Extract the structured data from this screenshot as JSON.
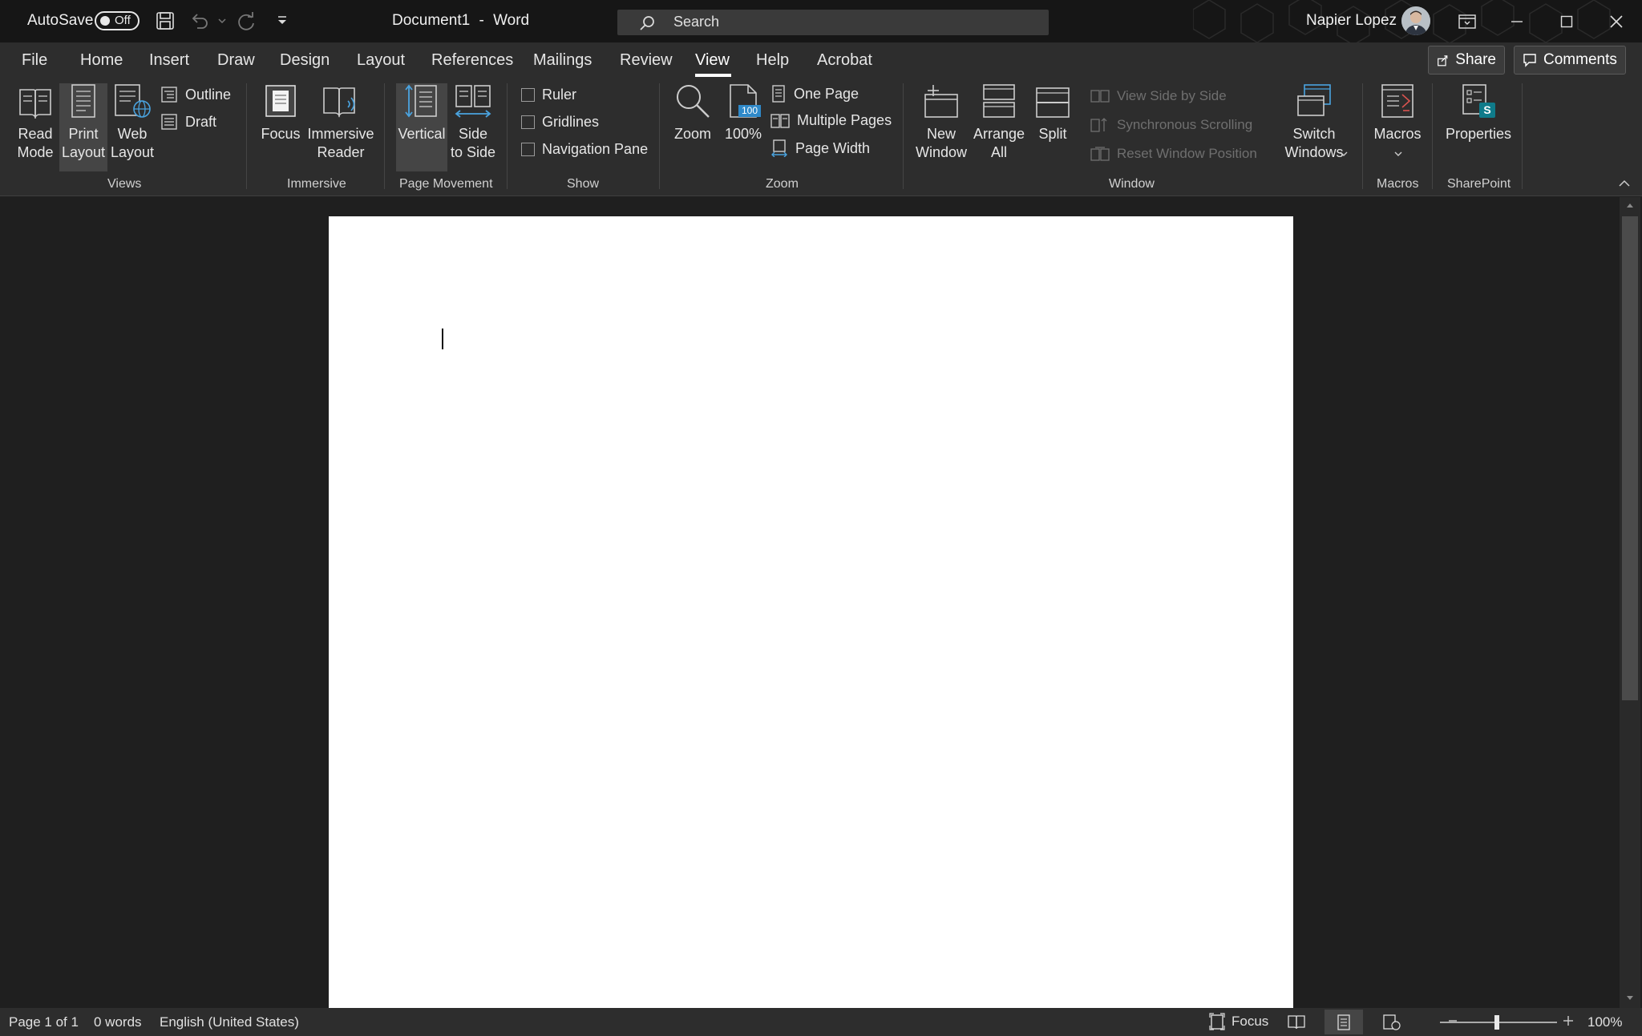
{
  "titlebar": {
    "autosave_label": "AutoSave",
    "autosave_state": "Off",
    "document_title": "Document1",
    "title_separator": "-",
    "app_name": "Word",
    "search_placeholder": "Search",
    "user_name": "Napier Lopez"
  },
  "tabs": [
    "File",
    "Home",
    "Insert",
    "Draw",
    "Design",
    "Layout",
    "References",
    "Mailings",
    "Review",
    "View",
    "Help",
    "Acrobat"
  ],
  "active_tab": "View",
  "share_label": "Share",
  "comments_label": "Comments",
  "ribbon": {
    "views": {
      "read_mode": [
        "Read",
        "Mode"
      ],
      "print_layout": [
        "Print",
        "Layout"
      ],
      "web_layout": [
        "Web",
        "Layout"
      ],
      "outline": "Outline",
      "draft": "Draft",
      "group": "Views"
    },
    "immersive": {
      "focus": "Focus",
      "immersive_reader": [
        "Immersive",
        "Reader"
      ],
      "group": "Immersive"
    },
    "page_movement": {
      "vertical": "Vertical",
      "side_to_side": [
        "Side",
        "to Side"
      ],
      "group": "Page Movement"
    },
    "show": {
      "ruler": "Ruler",
      "gridlines": "Gridlines",
      "navigation_pane": "Navigation Pane",
      "group": "Show"
    },
    "zoom": {
      "zoom": "Zoom",
      "hundred": "100%",
      "hundred_badge": "100",
      "one_page": "One Page",
      "multiple_pages": "Multiple Pages",
      "page_width": "Page Width",
      "group": "Zoom"
    },
    "window": {
      "new_window": [
        "New",
        "Window"
      ],
      "arrange_all": [
        "Arrange",
        "All"
      ],
      "split": "Split",
      "view_side_by_side": "View Side by Side",
      "synchronous_scrolling": "Synchronous Scrolling",
      "reset_window_position": "Reset Window Position",
      "switch_windows": [
        "Switch",
        "Windows"
      ],
      "group": "Window"
    },
    "macros": {
      "macros": "Macros",
      "group": "Macros"
    },
    "sharepoint": {
      "properties": "Properties",
      "badge": "S",
      "group": "SharePoint"
    }
  },
  "statusbar": {
    "page": "Page 1 of 1",
    "words": "0 words",
    "language": "English (United States)",
    "focus": "Focus",
    "zoom_level": "100%"
  },
  "colors": {
    "titlebar_bg": "#161616",
    "ribbon_bg": "#2d2d2d",
    "canvas_bg": "#1f1f1f",
    "page_bg": "#ffffff",
    "accent_blue": "#4aa3df"
  }
}
